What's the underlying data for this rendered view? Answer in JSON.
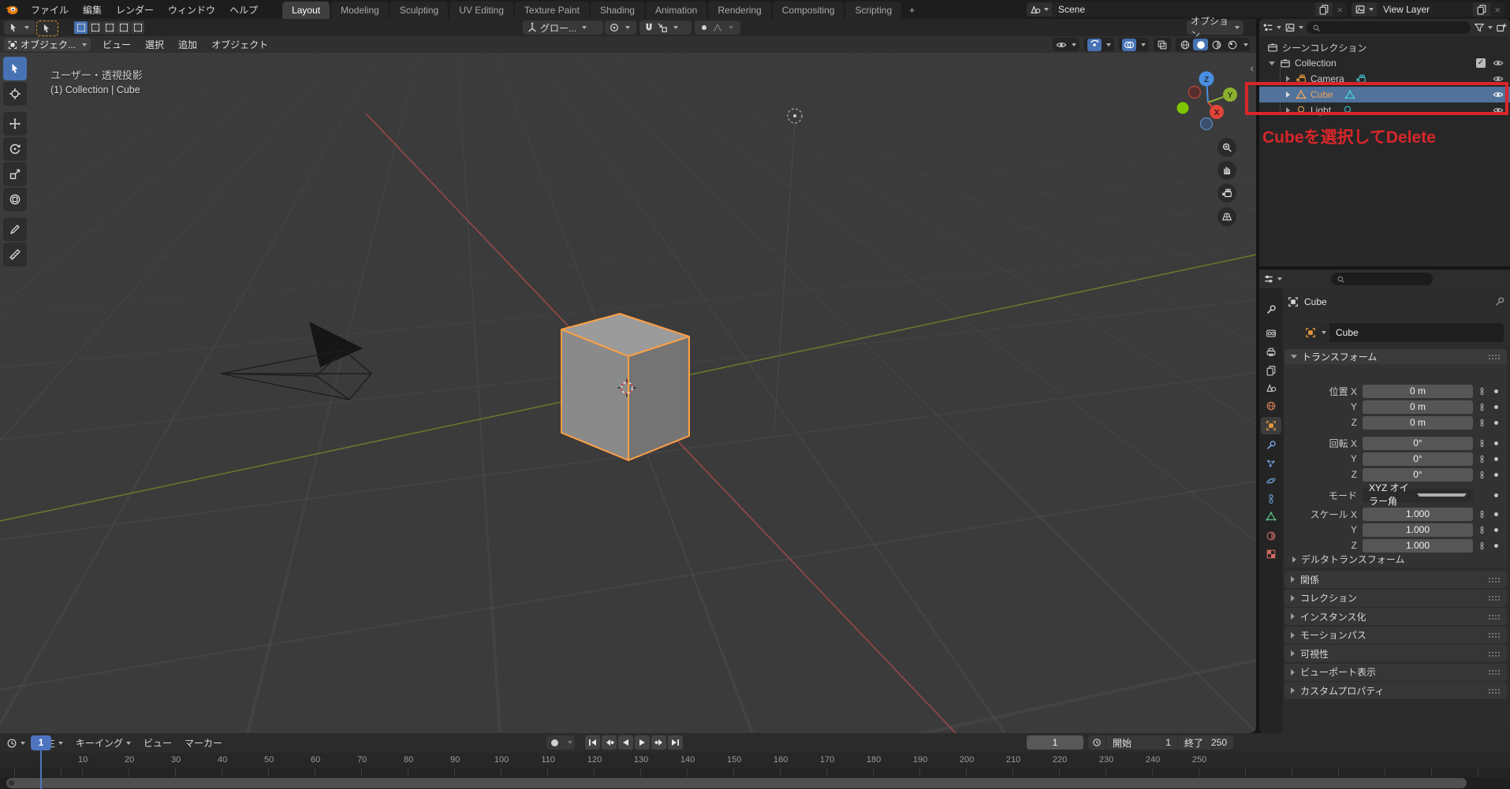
{
  "colors": {
    "accent": "#4772b3",
    "selection": "#50729b",
    "object-orange": "#f0a45c",
    "annotation-red": "#d8262b",
    "axis-red": "#a34b4b",
    "axis-green": "#6b7f2e",
    "cube-outline": "#ffa044"
  },
  "topbar": {
    "menus": [
      "ファイル",
      "編集",
      "レンダー",
      "ウィンドウ",
      "ヘルプ"
    ],
    "tabs": [
      "Layout",
      "Modeling",
      "Sculpting",
      "UV Editing",
      "Texture Paint",
      "Shading",
      "Animation",
      "Rendering",
      "Compositing",
      "Scripting"
    ],
    "new_tab": "+",
    "scene_selector": {
      "value": "Scene"
    },
    "view_layer_selector": {
      "value": "View Layer"
    }
  },
  "tool_settings": {
    "orientation": "グロー...",
    "options": "オプション"
  },
  "viewport": {
    "mode": "オブジェク...",
    "menus": [
      "ビュー",
      "選択",
      "追加",
      "オブジェクト"
    ],
    "overlay": {
      "view_label": "ユーザー・透視投影",
      "context_label": "(1) Collection | Cube"
    },
    "gizmo": {
      "x": "X",
      "y": "Y",
      "z": "Z"
    }
  },
  "outliner": {
    "scene_collection": "シーンコレクション",
    "collection": "Collection",
    "objects": [
      {
        "name": "Camera",
        "type": "camera"
      },
      {
        "name": "Cube",
        "type": "mesh",
        "selected": true
      },
      {
        "name": "Light",
        "type": "light"
      }
    ],
    "annotation": "Cubeを選択してDelete"
  },
  "properties": {
    "breadcrumb": "Cube",
    "object_name": "Cube",
    "transform": {
      "title": "トランスフォーム",
      "rows": [
        {
          "label": "位置 X",
          "value": "0 m"
        },
        {
          "label": "Y",
          "value": "0 m"
        },
        {
          "label": "Z",
          "value": "0 m"
        },
        {
          "label": "回転 X",
          "value": "0°"
        },
        {
          "label": "Y",
          "value": "0°"
        },
        {
          "label": "Z",
          "value": "0°"
        },
        {
          "label": "モード",
          "value": "XYZ オイラー角"
        },
        {
          "label": "スケール X",
          "value": "1.000"
        },
        {
          "label": "Y",
          "value": "1.000"
        },
        {
          "label": "Z",
          "value": "1.000"
        }
      ],
      "delta": "デルタトランスフォーム"
    },
    "sections": [
      "関係",
      "コレクション",
      "インスタンス化",
      "モーションパス",
      "可視性",
      "ビューポート表示",
      "カスタムプロパティ"
    ]
  },
  "timeline": {
    "menus": [
      "再生",
      "キーイング",
      "ビュー",
      "マーカー"
    ],
    "current_frame": "1",
    "start_label": "開始",
    "start_value": "1",
    "end_label": "終了",
    "end_value": "250",
    "playhead_frame": 1,
    "ruler_labels": [
      10,
      20,
      30,
      40,
      50,
      60,
      70,
      80,
      90,
      100,
      110,
      120,
      130,
      140,
      150,
      160,
      170,
      180,
      190,
      200,
      210,
      220,
      230,
      240,
      250
    ]
  },
  "icons": {
    "search": "magnifier glyph",
    "eye": "visibility eye",
    "magnet": "snap magnet",
    "funnel": "filter funnel",
    "clock": "time clock",
    "copy": "duplicate pages",
    "pin": "pushpin",
    "padlock": "open padlock (unlocked)"
  }
}
